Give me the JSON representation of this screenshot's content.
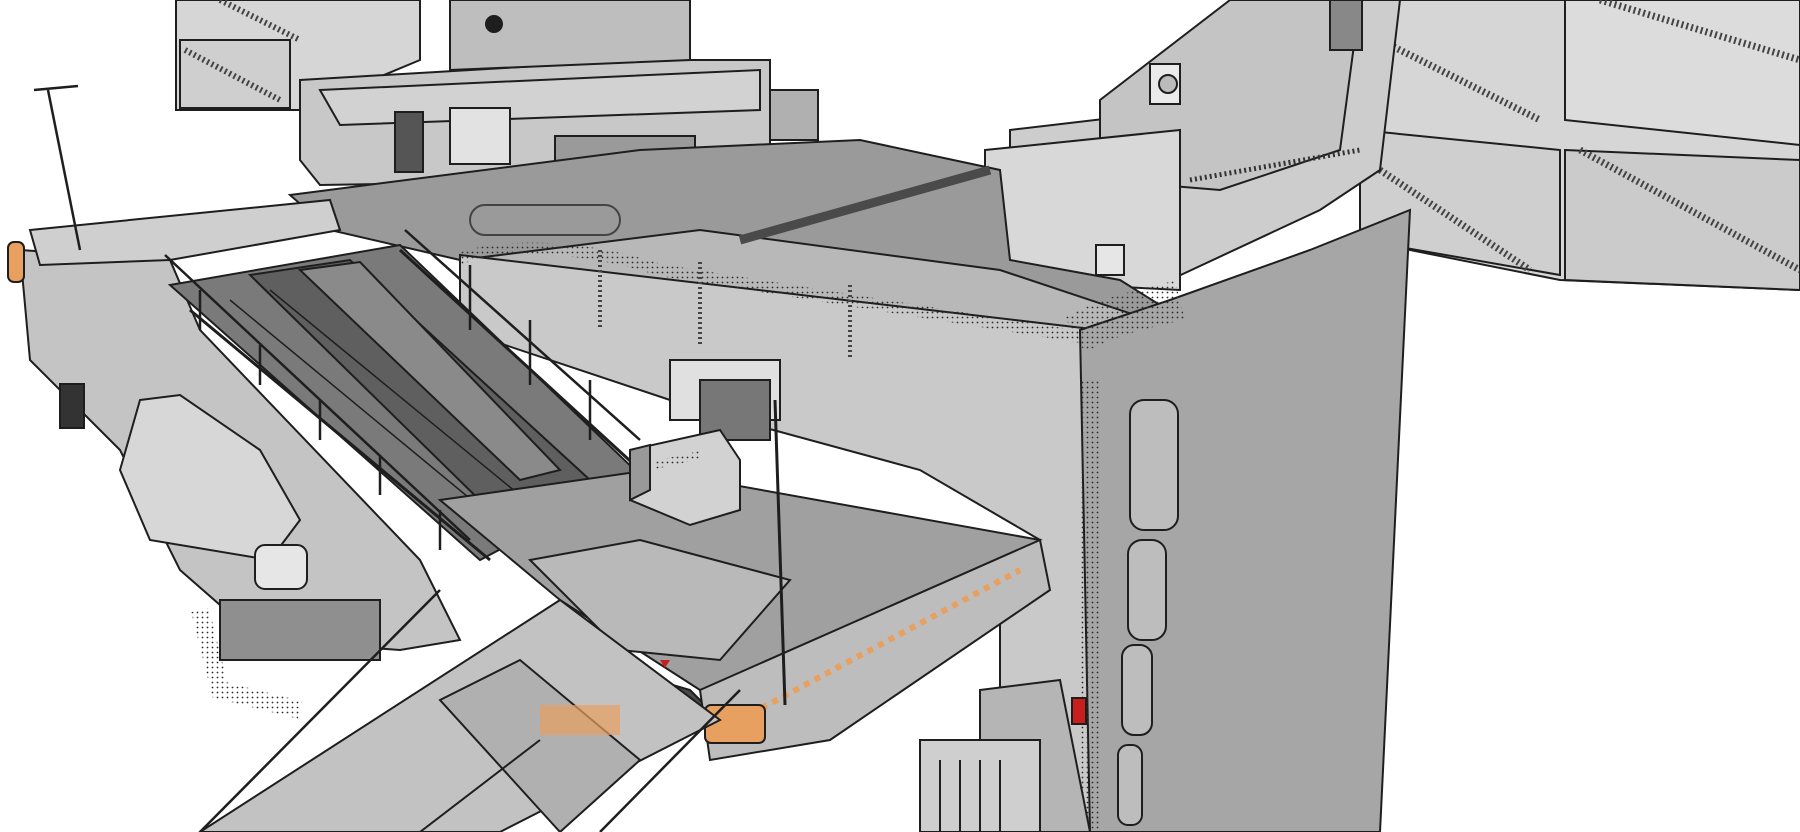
{
  "scene": {
    "kind": "sketch-style 3D render of a sci-fi hangar / landing platform module",
    "background_color": "#ffffff",
    "palette": {
      "light_panel": "#d3d3d3",
      "mid_panel": "#bdbdbd",
      "dark_panel": "#8f8f8f",
      "shadow_panel": "#6e6e6e",
      "outline": "#1e1e1e",
      "accent_orange": "#e8a060",
      "accent_red": "#c81e1e"
    }
  }
}
